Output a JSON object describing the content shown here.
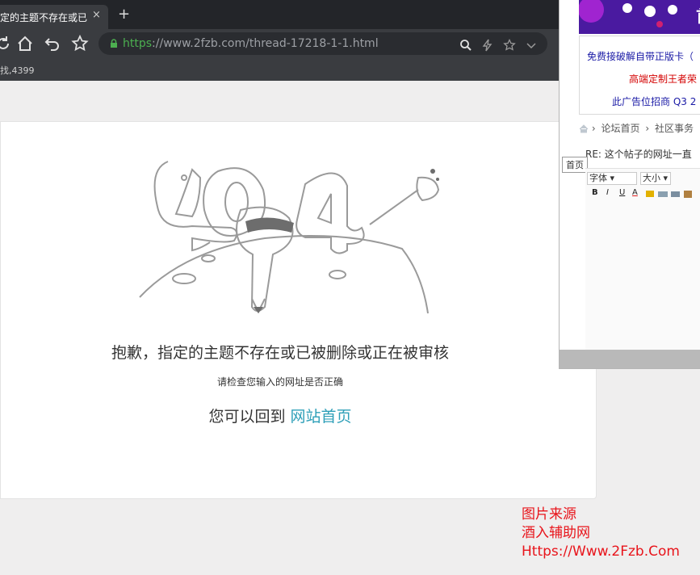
{
  "browser": {
    "tab_title": "定的主题不存在或已被删除",
    "tab_close": "×",
    "new_tab": "+",
    "url_scheme": "https",
    "url_rest": "://www.2fzb.com/thread-17218-1-1.html",
    "bookmark": "找,4399"
  },
  "error": {
    "title": "抱歉，指定的主题不存在或已被删除或正在被审核",
    "subtitle": "请检查您输入的网址是否正确",
    "back_text": "您可以回到",
    "home_link": "网站首页"
  },
  "panel": {
    "ad_title": "首",
    "ad_line1": "免费接破解自带正版卡（",
    "ad_line2": "高端定制王者荣",
    "ad_line3": "此广告位招商 Q3 2",
    "breadcrumb_home": "论坛首页",
    "breadcrumb_section": "社区事务",
    "post_title": "RE: 这个帖子的网址一直",
    "tooltip": "首页",
    "font_select": "字体",
    "size_select": "大小",
    "fmt_bold": "B",
    "fmt_italic": "I",
    "fmt_underline": "U",
    "fmt_color": "A"
  },
  "watermark": {
    "line1": "图片来源",
    "line2": "酒入辅助网",
    "line3": "Https://Www.2Fzb.Com"
  },
  "colors": {
    "link": "#2e9fb8",
    "watermark": "#e8141b",
    "url_scheme": "#4caf50",
    "ad_blue": "#1a1aa6",
    "ad_red": "#d40000"
  }
}
